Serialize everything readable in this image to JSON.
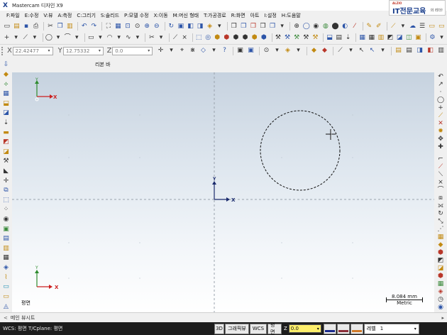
{
  "window": {
    "title": "Mastercam 디자인 X9"
  },
  "brand": {
    "small": "ALZIO",
    "big": "IT전문교육",
    "tail": "의 리더!"
  },
  "menu": [
    {
      "name": "menu-file",
      "label": "F:파일"
    },
    {
      "name": "menu-edit",
      "label": "E:수정"
    },
    {
      "name": "menu-view",
      "label": "V:뷰"
    },
    {
      "name": "menu-analyze",
      "label": "A:측정"
    },
    {
      "name": "menu-create",
      "label": "C:그리기"
    },
    {
      "name": "menu-solids",
      "label": "S:솔리드"
    },
    {
      "name": "menu-model-prep",
      "label": "P:모델 수정"
    },
    {
      "name": "menu-xform",
      "label": "X:이동"
    },
    {
      "name": "menu-machine",
      "label": "M:머신 형태"
    },
    {
      "name": "menu-toolpaths",
      "label": "T:가공경로"
    },
    {
      "name": "menu-screen",
      "label": "R:화면"
    },
    {
      "name": "menu-art",
      "label": "아트"
    },
    {
      "name": "menu-settings",
      "label": "I:설정"
    },
    {
      "name": "menu-help",
      "label": "H:도움말"
    }
  ],
  "toolbar1": [
    {
      "n": "new-file-icon",
      "g": "▭",
      "c": "k"
    },
    {
      "n": "open-file-icon",
      "g": "▤",
      "c": "y"
    },
    {
      "n": "save-icon",
      "g": "▪",
      "c": ""
    },
    {
      "n": "print-icon",
      "g": "⎙",
      "c": "k"
    },
    {
      "n": "sep"
    },
    {
      "n": "cut-icon",
      "g": "✂",
      "c": "k"
    },
    {
      "n": "copy-icon",
      "g": "❐",
      "c": ""
    },
    {
      "n": "paste-icon",
      "g": "▥",
      "c": "y"
    },
    {
      "n": "sep"
    },
    {
      "n": "undo-icon",
      "g": "↶",
      "c": ""
    },
    {
      "n": "redo-icon",
      "g": "↷",
      "c": ""
    },
    {
      "n": "sep"
    },
    {
      "n": "fit-icon",
      "g": "⛶",
      "c": "k"
    },
    {
      "n": "repaint-icon",
      "g": "▦",
      "c": ""
    },
    {
      "n": "zoom-window-icon",
      "g": "⊡",
      "c": ""
    },
    {
      "n": "zoom-target-icon",
      "g": "⊙",
      "c": "k"
    },
    {
      "n": "zoom-in-icon",
      "g": "⊕",
      "c": ""
    },
    {
      "n": "zoom-out-icon",
      "g": "⊖",
      "c": ""
    },
    {
      "n": "sep"
    },
    {
      "n": "rotate-icon",
      "g": "↻",
      "c": ""
    },
    {
      "n": "view-top-icon",
      "g": "▣",
      "c": ""
    },
    {
      "n": "view-front-icon",
      "g": "◧",
      "c": ""
    },
    {
      "n": "view-side-icon",
      "g": "◨",
      "c": ""
    },
    {
      "n": "view-iso-icon",
      "g": "◈",
      "c": "y"
    },
    {
      "n": "view-dropdown-icon",
      "g": "▾",
      "c": "k"
    },
    {
      "n": "sep"
    },
    {
      "n": "cube-icon",
      "g": "❒",
      "c": "k"
    },
    {
      "n": "cube2-icon",
      "g": "❒",
      "c": ""
    },
    {
      "n": "cube3-icon",
      "g": "❒",
      "c": "r"
    },
    {
      "n": "cube4-icon",
      "g": "❒",
      "c": "k"
    },
    {
      "n": "cube5-icon",
      "g": "❒",
      "c": ""
    },
    {
      "n": "cube-dropdown-icon",
      "g": "▾",
      "c": "k"
    },
    {
      "n": "sep"
    },
    {
      "n": "globe-icon",
      "g": "⊕",
      "c": "k"
    },
    {
      "n": "sphere-icon",
      "g": "◯",
      "c": ""
    },
    {
      "n": "shade-icon",
      "g": "◉",
      "c": "k"
    },
    {
      "n": "shade2-icon",
      "g": "◍",
      "c": "g"
    },
    {
      "n": "shade3-icon",
      "g": "⬤",
      "c": "k"
    },
    {
      "n": "shade4-icon",
      "g": "◐",
      "c": ""
    },
    {
      "n": "slash-icon",
      "g": "⁄",
      "c": "r"
    },
    {
      "n": "sep"
    },
    {
      "n": "pencil-icon",
      "g": "✎",
      "c": "y"
    },
    {
      "n": "marker-icon",
      "g": "✐",
      "c": "y"
    },
    {
      "n": "sep"
    },
    {
      "n": "wand-icon",
      "g": "⟋",
      "c": "y"
    },
    {
      "n": "wand-dropdown-icon",
      "g": "▾",
      "c": "k"
    },
    {
      "n": "cloud-icon",
      "g": "☁",
      "c": ""
    },
    {
      "n": "lines-icon",
      "g": "☰",
      "c": "k"
    },
    {
      "n": "folder-icon",
      "g": "▭",
      "c": "y"
    },
    {
      "n": "folder2-icon",
      "g": "▭",
      "c": "y"
    }
  ],
  "toolbar2": [
    {
      "n": "point-icon",
      "g": "+",
      "c": "k"
    },
    {
      "n": "point-dropdown-icon",
      "g": "▾",
      "c": "k"
    },
    {
      "n": "line-icon",
      "g": "⟋",
      "c": "k"
    },
    {
      "n": "line-dropdown-icon",
      "g": "▾",
      "c": "k"
    },
    {
      "n": "sep"
    },
    {
      "n": "circle-icon",
      "g": "◯",
      "c": "k"
    },
    {
      "n": "circle-dropdown-icon",
      "g": "▾",
      "c": "k"
    },
    {
      "n": "fillet-icon",
      "g": "⌒",
      "c": "k"
    },
    {
      "n": "fillet-dropdown-icon",
      "g": "▾",
      "c": "k"
    },
    {
      "n": "sep"
    },
    {
      "n": "rectangle-icon",
      "g": "▭",
      "c": "k"
    },
    {
      "n": "rectangle-dropdown-icon",
      "g": "▾",
      "c": "k"
    },
    {
      "n": "arc-icon",
      "g": "◠",
      "c": "k"
    },
    {
      "n": "arc-dropdown-icon",
      "g": "▾",
      "c": "k"
    },
    {
      "n": "spline-icon",
      "g": "∿",
      "c": "k"
    },
    {
      "n": "spline-dropdown-icon",
      "g": "▾",
      "c": "k"
    },
    {
      "n": "sep"
    },
    {
      "n": "trim-icon",
      "g": "✂",
      "c": "k"
    },
    {
      "n": "trim-dropdown-icon",
      "g": "▾",
      "c": "k"
    },
    {
      "n": "sep"
    },
    {
      "n": "chamfer-icon",
      "g": "⟋",
      "c": "k"
    },
    {
      "n": "break-icon",
      "g": "⨯",
      "c": "k"
    },
    {
      "n": "sep"
    },
    {
      "n": "solid-extrude-icon",
      "g": "⬚",
      "c": ""
    },
    {
      "n": "solid-revolve-icon",
      "g": "◎",
      "c": ""
    },
    {
      "n": "solid-icon",
      "g": "⬢",
      "c": "y"
    },
    {
      "n": "solid2-icon",
      "g": "⬢",
      "c": "r"
    },
    {
      "n": "solid3-icon",
      "g": "⬢",
      "c": "k"
    },
    {
      "n": "solid4-icon",
      "g": "⬢",
      "c": "k"
    },
    {
      "n": "solid5-icon",
      "g": "⬢",
      "c": "y"
    },
    {
      "n": "solid6-icon",
      "g": "⬢",
      "c": ""
    },
    {
      "n": "sep"
    },
    {
      "n": "mill-icon",
      "g": "⚒",
      "c": "k"
    },
    {
      "n": "mill2-icon",
      "g": "⚒",
      "c": ""
    },
    {
      "n": "mill3-icon",
      "g": "⚒",
      "c": "g"
    },
    {
      "n": "mill4-icon",
      "g": "⚒",
      "c": "k"
    },
    {
      "n": "mill5-icon",
      "g": "⚒",
      "c": "y"
    },
    {
      "n": "sep"
    },
    {
      "n": "contour-icon",
      "g": "⬓",
      "c": ""
    },
    {
      "n": "pocket-icon",
      "g": "▤",
      "c": "k"
    },
    {
      "n": "drill-icon",
      "g": "⇣",
      "c": "k"
    },
    {
      "n": "sep"
    },
    {
      "n": "face-icon",
      "g": "▦",
      "c": ""
    },
    {
      "n": "table-icon",
      "g": "▦",
      "c": "k"
    },
    {
      "n": "surface-icon",
      "g": "▥",
      "c": "y"
    },
    {
      "n": "surface2-icon",
      "g": "◩",
      "c": "k"
    },
    {
      "n": "surface3-icon",
      "g": "◪",
      "c": ""
    },
    {
      "n": "surface4-icon",
      "g": "◫",
      "c": "g"
    },
    {
      "n": "surface5-icon",
      "g": "▣",
      "c": "y"
    },
    {
      "n": "sep"
    },
    {
      "n": "settings-icon",
      "g": "⚙",
      "c": ""
    },
    {
      "n": "settings-dropdown-icon",
      "g": "▾",
      "c": "k"
    }
  ],
  "coords": {
    "x_label": "X",
    "x_value": "22.42477",
    "y_label": "Y",
    "y_value": "12.75332",
    "z_label": "Z",
    "z_value": "0.0"
  },
  "coord_tools": [
    {
      "n": "snap-icon",
      "g": "✛",
      "c": "k"
    },
    {
      "n": "snap-dropdown-icon",
      "g": "▾",
      "c": "k"
    },
    {
      "n": "auto-cursor-icon",
      "g": "⌖",
      "c": "k"
    },
    {
      "n": "snap-grid-icon",
      "g": "⋇",
      "c": "k"
    },
    {
      "n": "snap2-icon",
      "g": "◇",
      "c": ""
    },
    {
      "n": "snap-dd2-icon",
      "g": "▾",
      "c": "k"
    },
    {
      "n": "help-icon",
      "g": "?",
      "c": ""
    },
    {
      "n": "sep"
    },
    {
      "n": "cplane-icon",
      "g": "▣",
      "c": "k"
    },
    {
      "n": "tplane-icon",
      "g": "▣",
      "c": ""
    },
    {
      "n": "sep"
    },
    {
      "n": "target-icon",
      "g": "⊙",
      "c": "k"
    },
    {
      "n": "target-dropdown-icon",
      "g": "▾",
      "c": "k"
    },
    {
      "n": "plane-icon",
      "g": "◈",
      "c": "y"
    },
    {
      "n": "plane-dropdown-icon",
      "g": "▾",
      "c": "k"
    },
    {
      "n": "sep"
    },
    {
      "n": "attrib-icon",
      "g": "◆",
      "c": "y"
    },
    {
      "n": "attrib2-icon",
      "g": "◆",
      "c": "r"
    },
    {
      "n": "sep"
    },
    {
      "n": "linestyle-icon",
      "g": "⟋",
      "c": "k"
    },
    {
      "n": "linestyle-dropdown-icon",
      "g": "▾",
      "c": "k"
    },
    {
      "n": "cursor-icon",
      "g": "↖",
      "c": "k"
    },
    {
      "n": "cursor2-icon",
      "g": "↖",
      "c": ""
    },
    {
      "n": "cursor-dropdown-icon",
      "g": "▾",
      "c": "k"
    },
    {
      "n": "sep"
    },
    {
      "n": "layer-icon",
      "g": "▤",
      "c": "y"
    },
    {
      "n": "layer2-icon",
      "g": "▤",
      "c": "k"
    },
    {
      "n": "layer3-icon",
      "g": "◨",
      "c": ""
    },
    {
      "n": "layer4-icon",
      "g": "◧",
      "c": "r"
    },
    {
      "n": "layer5-icon",
      "g": "▥",
      "c": "k"
    }
  ],
  "ribbon": {
    "label": "리본 바"
  },
  "left_tools": [
    {
      "n": "toolpath-manager-icon",
      "g": "⇩",
      "c": ""
    },
    {
      "n": "solids-manager-icon",
      "g": "◆",
      "c": "y"
    },
    {
      "n": "art-manager-icon",
      "g": "⟡",
      "c": "g"
    },
    {
      "n": "level-manager-icon",
      "g": "▦",
      "c": ""
    },
    {
      "n": "contour-tp-icon",
      "g": "⬓",
      "c": "y"
    },
    {
      "n": "pocket-tp-icon",
      "g": "◪",
      "c": ""
    },
    {
      "n": "drill-tp-icon",
      "g": "⇣",
      "c": "k"
    },
    {
      "n": "facing-tp-icon",
      "g": "▬",
      "c": "y"
    },
    {
      "n": "surface-rough-icon",
      "g": "◩",
      "c": "r"
    },
    {
      "n": "surface-finish-icon",
      "g": "◪",
      "c": "y"
    },
    {
      "n": "tool-icon",
      "g": "⚒",
      "c": "k"
    },
    {
      "n": "blade-icon",
      "g": "◣",
      "c": "k"
    },
    {
      "n": "move-icon",
      "g": "✛",
      "c": "k"
    },
    {
      "n": "chain-icon",
      "g": "⧉",
      "c": ""
    },
    {
      "n": "select-icon",
      "g": "⬚",
      "c": ""
    },
    {
      "n": "point-tp-icon",
      "g": "⁘",
      "c": "k"
    },
    {
      "n": "verify-icon",
      "g": "◉",
      "c": "k"
    },
    {
      "n": "simulate-icon",
      "g": "▣",
      "c": "g"
    },
    {
      "n": "post-icon",
      "g": "▤",
      "c": ""
    },
    {
      "n": "stock-icon",
      "g": "▥",
      "c": "y"
    },
    {
      "n": "level2-icon",
      "g": "▦",
      "c": "k"
    },
    {
      "n": "layers2-icon",
      "g": "◈",
      "c": ""
    },
    {
      "n": "wire-icon",
      "g": "⌇",
      "c": "y"
    },
    {
      "n": "sheet-icon",
      "g": "▭",
      "c": "c"
    },
    {
      "n": "sheet2-icon",
      "g": "▭",
      "c": "y"
    },
    {
      "n": "sheet3-icon",
      "g": "◬",
      "c": ""
    }
  ],
  "right_tools": [
    {
      "n": "undo-view-icon",
      "g": "↶",
      "c": "k"
    },
    {
      "n": "arrow-ne-icon",
      "g": "↗",
      "c": "k"
    },
    {
      "n": "point-icon",
      "g": "·",
      "c": "k"
    },
    {
      "n": "arc-tool-icon",
      "g": "◯",
      "c": "k"
    },
    {
      "n": "plus-tool-icon",
      "g": "+",
      "c": "k"
    },
    {
      "n": "line-tool-icon",
      "g": "⟋",
      "c": "y"
    },
    {
      "n": "cross-tool-icon",
      "g": "✕",
      "c": "r"
    },
    {
      "n": "gear-tool-icon",
      "g": "✹",
      "c": "y"
    },
    {
      "n": "move-tool-icon",
      "g": "✥",
      "c": "k"
    },
    {
      "n": "plus-tool2-icon",
      "g": "✚",
      "c": "k"
    },
    {
      "n": "sep"
    },
    {
      "n": "corner-icon",
      "g": "⌐",
      "c": "k"
    },
    {
      "n": "trim-tool-icon",
      "g": "⟋",
      "c": "r"
    },
    {
      "n": "extend-icon",
      "g": "⟍",
      "c": "k"
    },
    {
      "n": "break-tool-icon",
      "g": "⨯",
      "c": "k"
    },
    {
      "n": "fillet-tool-icon",
      "g": "⌒",
      "c": "k"
    },
    {
      "n": "offset-icon",
      "g": "⧈",
      "c": "k"
    },
    {
      "n": "mirror-icon",
      "g": "⟗",
      "c": "k"
    },
    {
      "n": "rotate-tool-icon",
      "g": "↻",
      "c": "k"
    },
    {
      "n": "scale-icon",
      "g": "⤡",
      "c": "k"
    },
    {
      "n": "array-icon",
      "g": "⋰",
      "c": "k"
    },
    {
      "n": "layer-tool-icon",
      "g": "▦",
      "c": "y"
    },
    {
      "n": "tool-y-icon",
      "g": "◆",
      "c": "y"
    },
    {
      "n": "solid-tool-icon",
      "g": "⬢",
      "c": "r"
    },
    {
      "n": "surface-tool-icon",
      "g": "◩",
      "c": "k"
    },
    {
      "n": "solid-tool2-icon",
      "g": "◪",
      "c": "y"
    },
    {
      "n": "solid-tool3-icon",
      "g": "⬢",
      "c": "r"
    },
    {
      "n": "sheet-tool-icon",
      "g": "▦",
      "c": "g"
    },
    {
      "n": "sheet-tool2-icon",
      "g": "◈",
      "c": "r"
    },
    {
      "n": "clock-icon",
      "g": "◷",
      "c": "k"
    },
    {
      "n": "orb-icon",
      "g": "◉",
      "c": ""
    }
  ],
  "viewport": {
    "view_label": "평면",
    "scale": {
      "value": "8.084 mm",
      "unit": "Metric"
    },
    "axes_origin_label_x": "X",
    "axes_origin_label_y": "Y",
    "axes_topleft_label_x": "X",
    "axes_topleft_label_y": "Y",
    "axes_bottomleft_label_x": "X",
    "axes_bottomleft_label_y": "Y",
    "colors": {
      "x_axis": "#cc1f1f",
      "y_axis": "#2e8b2e",
      "origin": "#1a2a6c"
    }
  },
  "tabs": {
    "arrow": "<",
    "main_viewsheet": "메인 뷰시트",
    "right_arrow": "▸"
  },
  "status": {
    "wcs_info": "WCS: 평면  T/Cplane: 평면",
    "btn_3d": "3D",
    "btn_gview": "그래픽뷰",
    "btn_wcs": "WCS",
    "btn_plane": "평면",
    "z_label": "Z",
    "z_value": "0.0",
    "level_label": "레벨",
    "level_value": "1",
    "colors": {
      "system": "#1a2a8c",
      "line": "#8b2f3a",
      "point": "#d07a2a"
    }
  }
}
